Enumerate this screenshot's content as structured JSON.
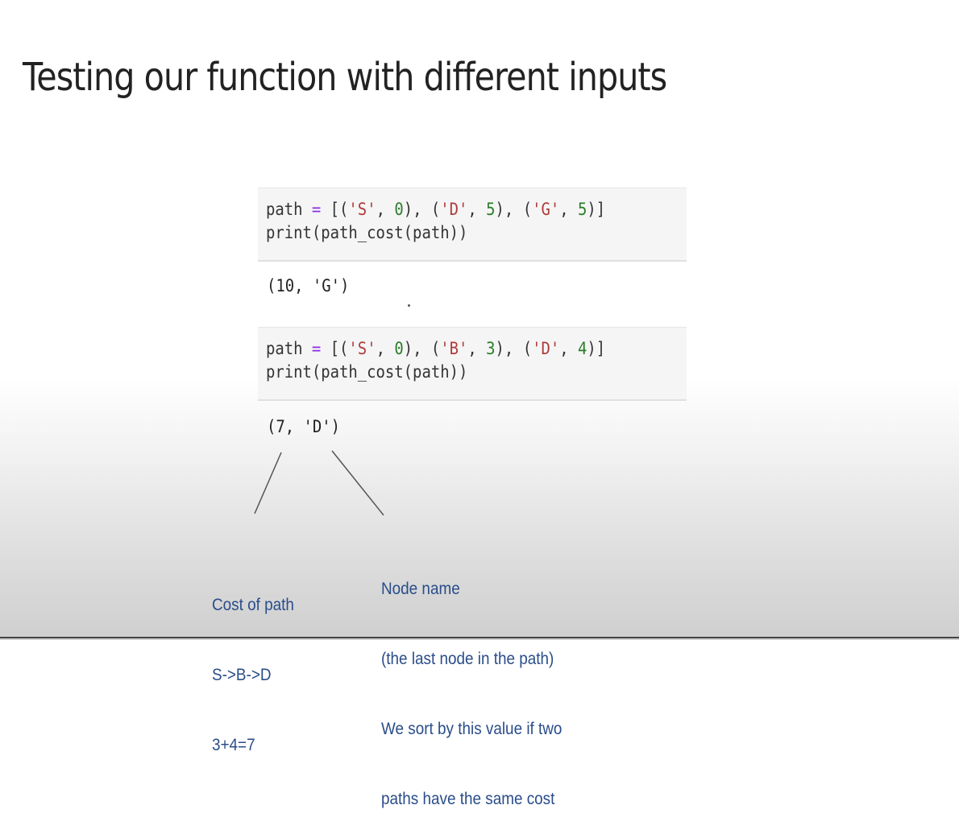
{
  "slide": {
    "title": "Testing our function with different inputs"
  },
  "cells": [
    {
      "line1": {
        "a": "path = [('S', 0), ('D', 5), ('G', 5)]"
      },
      "line2": "print(path_cost(path))",
      "output": "(10, 'G')"
    },
    {
      "line1": {
        "a": "path = [('S', 0), ('B', 3), ('D', 4)]"
      },
      "line2": "print(path_cost(path))",
      "output": "(7, 'D')"
    }
  ],
  "annotations": {
    "cost": [
      "Cost of path",
      "S->B->D",
      "3+4=7"
    ],
    "node": [
      "Node name",
      "(the last node in the path)",
      "We sort by this value if two",
      "paths have the same cost"
    ]
  },
  "colors": {
    "annotation_text": "#2a4d8a",
    "code_string": "#b03a3a",
    "code_number": "#2a7d2a"
  }
}
